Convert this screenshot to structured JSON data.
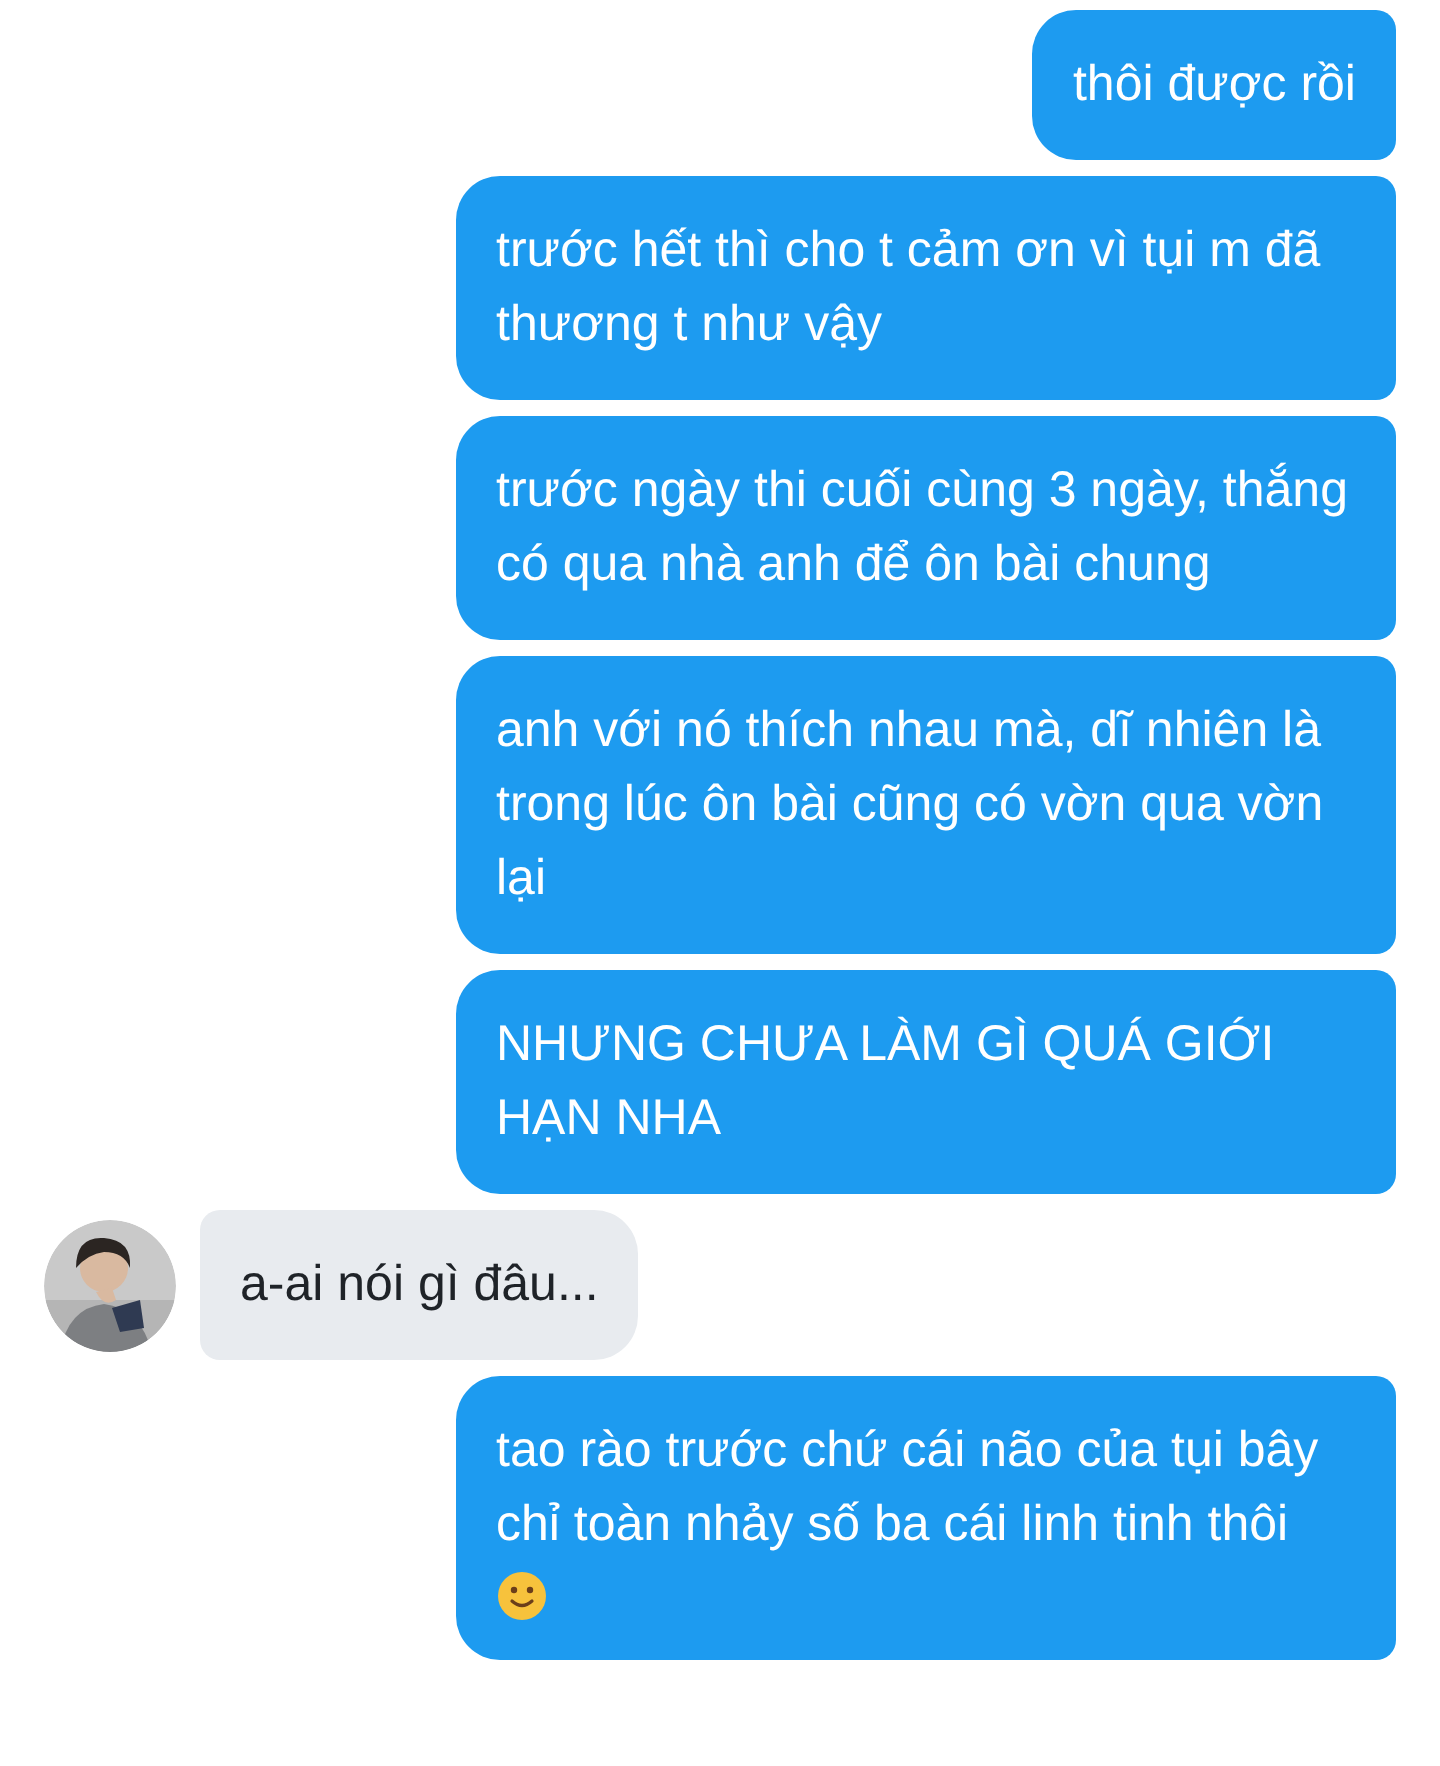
{
  "messages": [
    {
      "kind": "sent",
      "text": "thôi được rồi"
    },
    {
      "kind": "sent",
      "text": "trước hết thì cho t cảm ơn vì tụi m đã thương t như vậy"
    },
    {
      "kind": "sent",
      "text": "trước ngày thi cuối cùng 3 ngày, thắng có qua nhà anh để ôn bài chung"
    },
    {
      "kind": "sent",
      "text": "anh với nó thích nhau mà, dĩ nhiên là trong lúc ôn bài cũng có vờn qua vờn lại"
    },
    {
      "kind": "sent",
      "text": "NHƯNG CHƯA LÀM GÌ QUÁ GIỚI HẠN NHA"
    },
    {
      "kind": "received",
      "text": "a-ai nói gì đâu..."
    },
    {
      "kind": "sent",
      "text": "tao rào trước chứ cái não của tụi bây chỉ toàn nhảy số ba cái linh tinh thôi",
      "has_emoji": true
    }
  ]
}
